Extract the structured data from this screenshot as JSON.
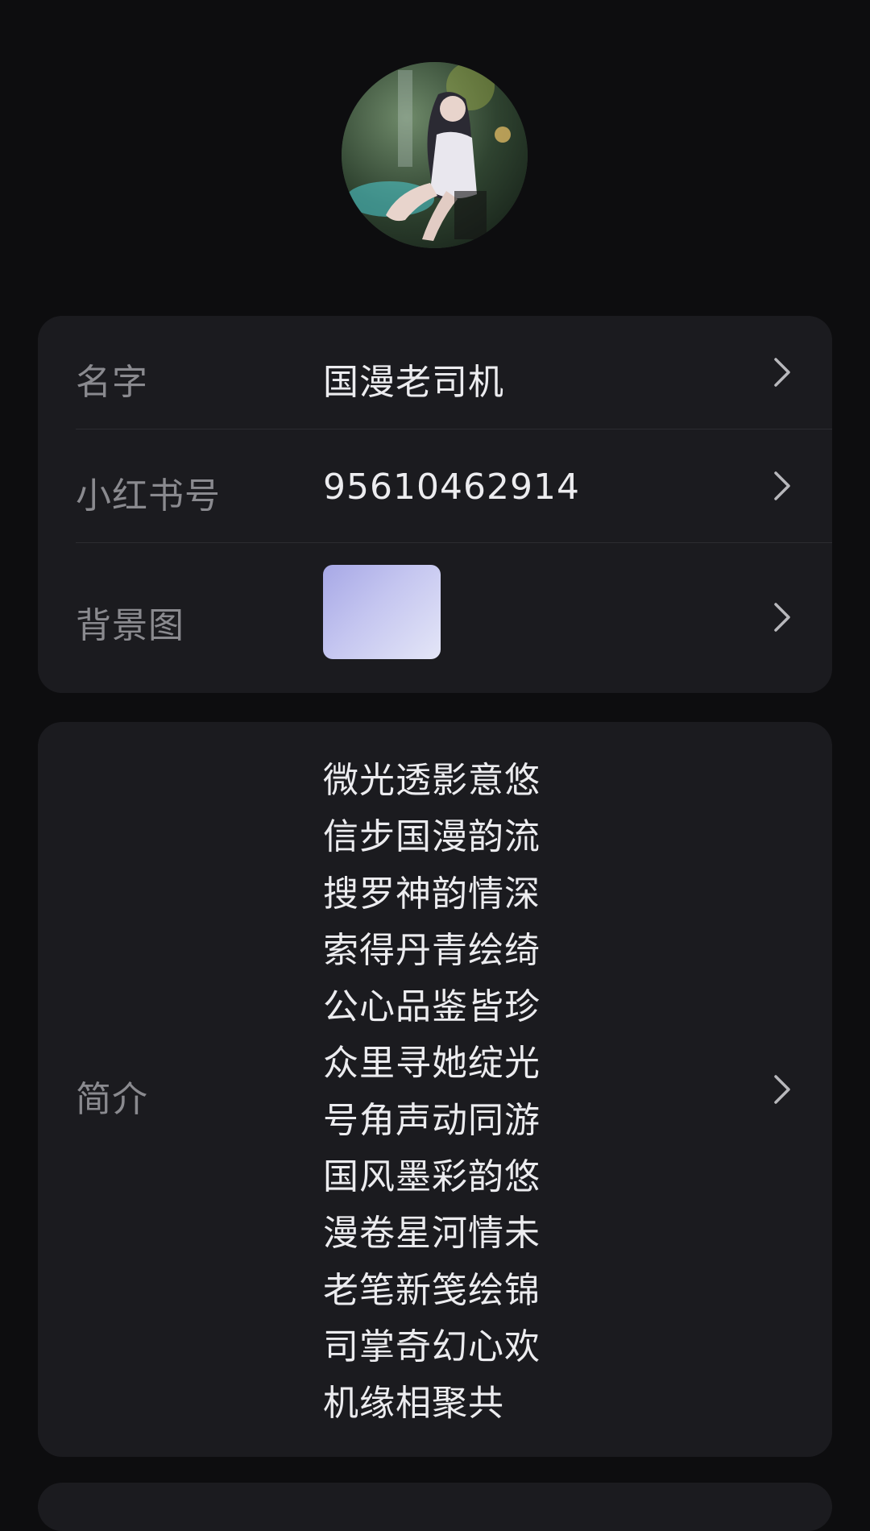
{
  "profile": {
    "avatar_icon": "avatar-image"
  },
  "info": {
    "name_label": "名字",
    "name_value": "国漫老司机",
    "id_label": "小红书号",
    "id_value": "95610462914",
    "background_label": "背景图"
  },
  "bio": {
    "label": "简介",
    "lines": [
      "微光透影意悠",
      "信步国漫韵流",
      "搜罗神韵情深",
      "索得丹青绘绮",
      "公心品鉴皆珍",
      "众里寻她绽光",
      "号角声动同游",
      "国风墨彩韵悠",
      "漫卷星河情未",
      "老笔新笺绘锦",
      "司掌奇幻心欢",
      "机缘相聚共"
    ]
  },
  "colors": {
    "background": "#0d0d0f",
    "card": "#1b1b1f",
    "label": "#8a8a8f",
    "value": "#ececef",
    "chevron": "#b8b8bc"
  }
}
